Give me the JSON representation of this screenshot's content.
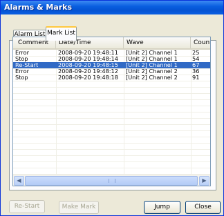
{
  "window": {
    "title": "Alarms & Marks"
  },
  "tabs": [
    {
      "label": "Alarm List",
      "active": false
    },
    {
      "label": "Mark List",
      "active": true
    }
  ],
  "list": {
    "columns": [
      "Comment",
      "Date/Time",
      "Wave",
      "Count"
    ],
    "rows": [
      {
        "comment": "Error",
        "datetime": "2008-09-20 19:48:11",
        "wave": "[Unit 2] Channel 1",
        "count": "25",
        "selected": false
      },
      {
        "comment": "Stop",
        "datetime": "2008-09-20 19:48:14",
        "wave": "[Unit 2] Channel 1",
        "count": "54",
        "selected": false
      },
      {
        "comment": "Re-Start",
        "datetime": "2008-09-20 19:48:15",
        "wave": "[Unit 2] Channel 1",
        "count": "67",
        "selected": true
      },
      {
        "comment": "Error",
        "datetime": "2008-09-20 19:48:12",
        "wave": "[Unit 2] Channel 2",
        "count": "36",
        "selected": false
      },
      {
        "comment": "Stop",
        "datetime": "2008-09-20 19:48:18",
        "wave": "[Unit 2] Channel 2",
        "count": "91",
        "selected": false
      }
    ]
  },
  "scrollbar": {
    "left_icon": "arrow-left-icon",
    "right_icon": "arrow-right-icon"
  },
  "buttons": {
    "restart": "Re-Start",
    "make_mark": "Make Mark",
    "jump": "Jump",
    "close": "Close"
  },
  "colors": {
    "titlebar": "#0a5fe0",
    "selection": "#316ac5",
    "active_tab_highlight": "#ffc83c"
  }
}
